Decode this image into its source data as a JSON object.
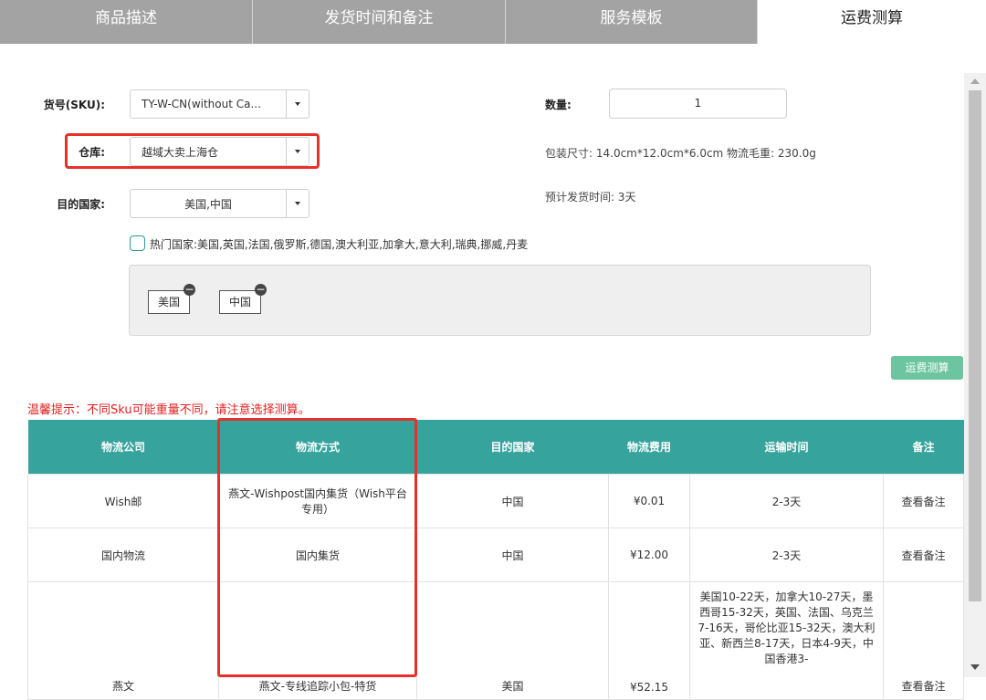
{
  "tabs": [
    {
      "label": "商品描述"
    },
    {
      "label": "发货时间和备注"
    },
    {
      "label": "服务模板"
    },
    {
      "label": "运费测算"
    }
  ],
  "form": {
    "sku_label": "货号(SKU):",
    "sku_value": "TY-W-CN(without Ca...",
    "warehouse_label": "仓库:",
    "warehouse_value": "越域大卖上海仓",
    "country_label": "目的国家:",
    "country_value": "美国,中国",
    "quantity_label": "数量:",
    "quantity_value": "1",
    "package_info": "包装尺寸: 14.0cm*12.0cm*6.0cm   物流毛重: 230.0g",
    "ship_time": "预计发货时间: 3天",
    "hot_countries": "热门国家:美国,英国,法国,俄罗斯,德国,澳大利亚,加拿大,意大利,瑞典,挪威,丹麦",
    "selected_tags": [
      "美国",
      "中国"
    ],
    "calc_button": "运费测算"
  },
  "tip": "温馨提示：不同Sku可能重量不同，请注意选择测算。",
  "table": {
    "headers": [
      "物流公司",
      "物流方式",
      "目的国家",
      "物流费用",
      "运输时间",
      "备注"
    ],
    "rows": [
      {
        "company": "Wish邮",
        "method": "燕文-Wishpost国内集货（Wish平台专用）",
        "country": "中国",
        "fee": "¥0.01",
        "time": "2-3天",
        "note": "查看备注"
      },
      {
        "company": "国内物流",
        "method": "国内集货",
        "country": "中国",
        "fee": "¥12.00",
        "time": "2-3天",
        "note": "查看备注"
      },
      {
        "company": "燕文",
        "method": "燕文-专线追踪小包-特货",
        "country": "美国",
        "fee": "¥52.15",
        "time": "美国10-22天，加拿大10-27天，墨西哥15-32天，英国、法国、乌克兰7-16天，哥伦比亚15-32天，澳大利亚、新西兰8-17天，日本4-9天，中国香港3-",
        "note": "查看备注"
      }
    ]
  },
  "colors": {
    "tab_inactive": "#a3a3a3",
    "header_teal": "#36a39c",
    "button_green": "#6cc5a0",
    "highlight_red": "#e8302a",
    "tip_red": "#e02020"
  }
}
